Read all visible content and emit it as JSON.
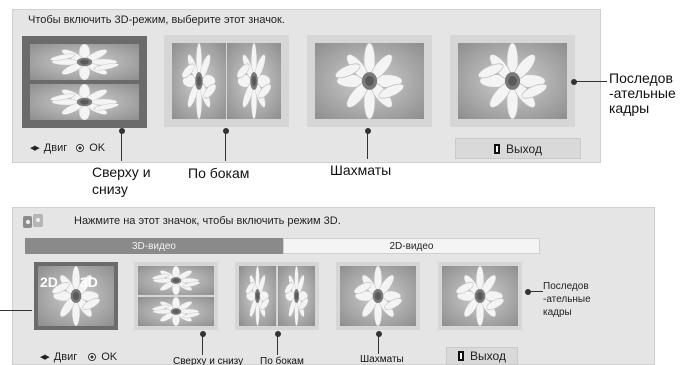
{
  "top": {
    "instruction": "Чтобы включить 3D-режим, выберите этот значок.",
    "nav": {
      "move_label": "Двиг",
      "ok_label": "OK"
    },
    "exit_label": "Выход",
    "callouts": {
      "top_bottom": [
        "Сверху и",
        "снизу"
      ],
      "side_by_side": "По бокам",
      "checkerboard": "Шахматы",
      "frame_sequential": [
        "Последов",
        "-ательные",
        "кадры"
      ]
    }
  },
  "bottom": {
    "instruction": "Нажмите на этот значок, чтобы включить режим 3D.",
    "tabs": [
      "3D-видео",
      "2D-видео"
    ],
    "thumb_badges": [
      "2D",
      "3D"
    ],
    "nav": {
      "move_label": "Двиг",
      "ok_label": "OK"
    },
    "exit_label": "Выход",
    "callouts": {
      "top_bottom": "Сверху и снизу",
      "side_by_side": "По бокам",
      "checkerboard": "Шахматы",
      "frame_sequential": [
        "Последов",
        "-ательные",
        "кадры"
      ]
    }
  },
  "icons": [
    "3d-mode-icon",
    "arrows-icon",
    "ok-icon",
    "exit-icon",
    "flower-thumbnail"
  ]
}
